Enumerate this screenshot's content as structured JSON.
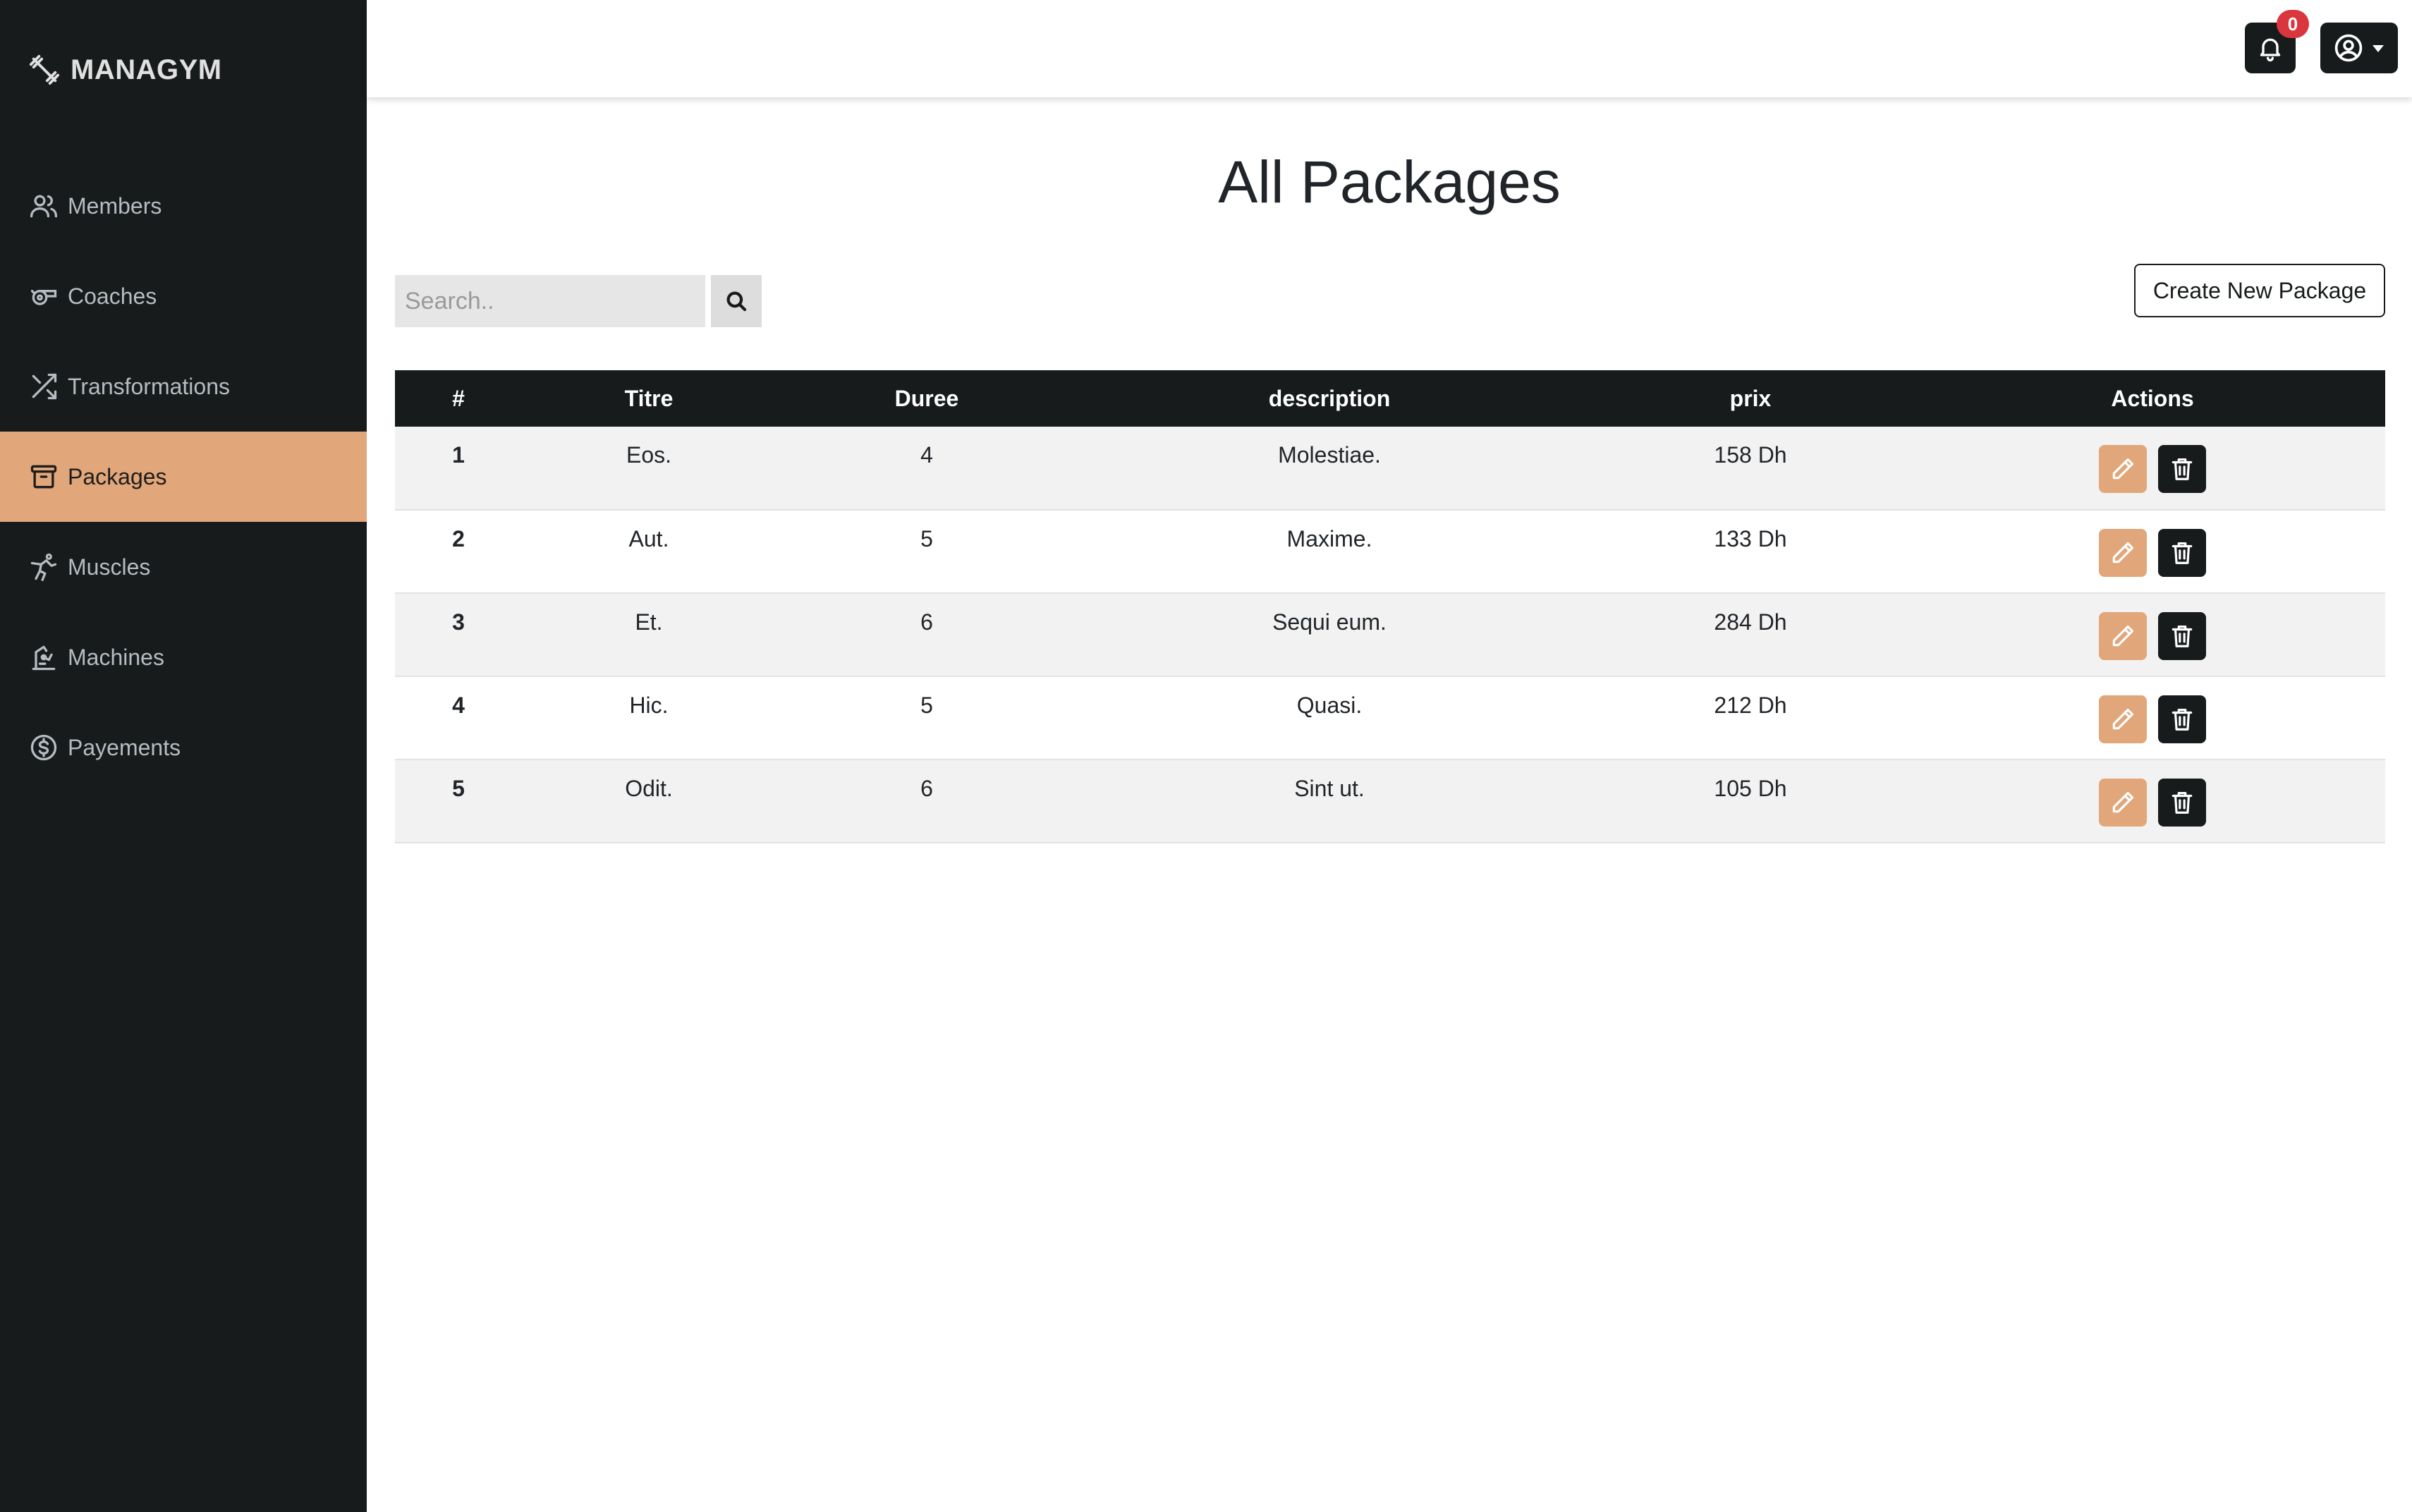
{
  "brand": {
    "name": "MANAGYM"
  },
  "sidebar": {
    "items": [
      {
        "label": "Members",
        "icon": "users-icon"
      },
      {
        "label": "Coaches",
        "icon": "whistle-icon"
      },
      {
        "label": "Transformations",
        "icon": "shuffle-icon"
      },
      {
        "label": "Packages",
        "icon": "archive-icon",
        "active": true
      },
      {
        "label": "Muscles",
        "icon": "karate-icon"
      },
      {
        "label": "Machines",
        "icon": "machine-icon"
      },
      {
        "label": "Payements",
        "icon": "currency-dollar-icon"
      }
    ]
  },
  "topbar": {
    "notifications_count": "0",
    "notification_icon": "bell-icon",
    "user_icon": "user-circle-icon"
  },
  "main": {
    "title": "All Packages",
    "search": {
      "placeholder": "Search..",
      "value": ""
    },
    "create_button": "Create New Package"
  },
  "table": {
    "headers": [
      "#",
      "Titre",
      "Duree",
      "description",
      "prix",
      "Actions"
    ],
    "rows": [
      {
        "id": "1",
        "titre": "Eos.",
        "duree": "4",
        "description": "Molestiae.",
        "prix": "158 Dh"
      },
      {
        "id": "2",
        "titre": "Aut.",
        "duree": "5",
        "description": "Maxime.",
        "prix": "133 Dh"
      },
      {
        "id": "3",
        "titre": "Et.",
        "duree": "6",
        "description": "Sequi eum.",
        "prix": "284 Dh"
      },
      {
        "id": "4",
        "titre": "Hic.",
        "duree": "5",
        "description": "Quasi.",
        "prix": "212 Dh"
      },
      {
        "id": "5",
        "titre": "Odit.",
        "duree": "6",
        "description": "Sint ut.",
        "prix": "105 Dh"
      }
    ]
  },
  "colors": {
    "sidebar_bg": "#171b1b",
    "accent": "#e1a67a",
    "badge": "#d9363e",
    "row_alt": "#f2f2f2"
  }
}
